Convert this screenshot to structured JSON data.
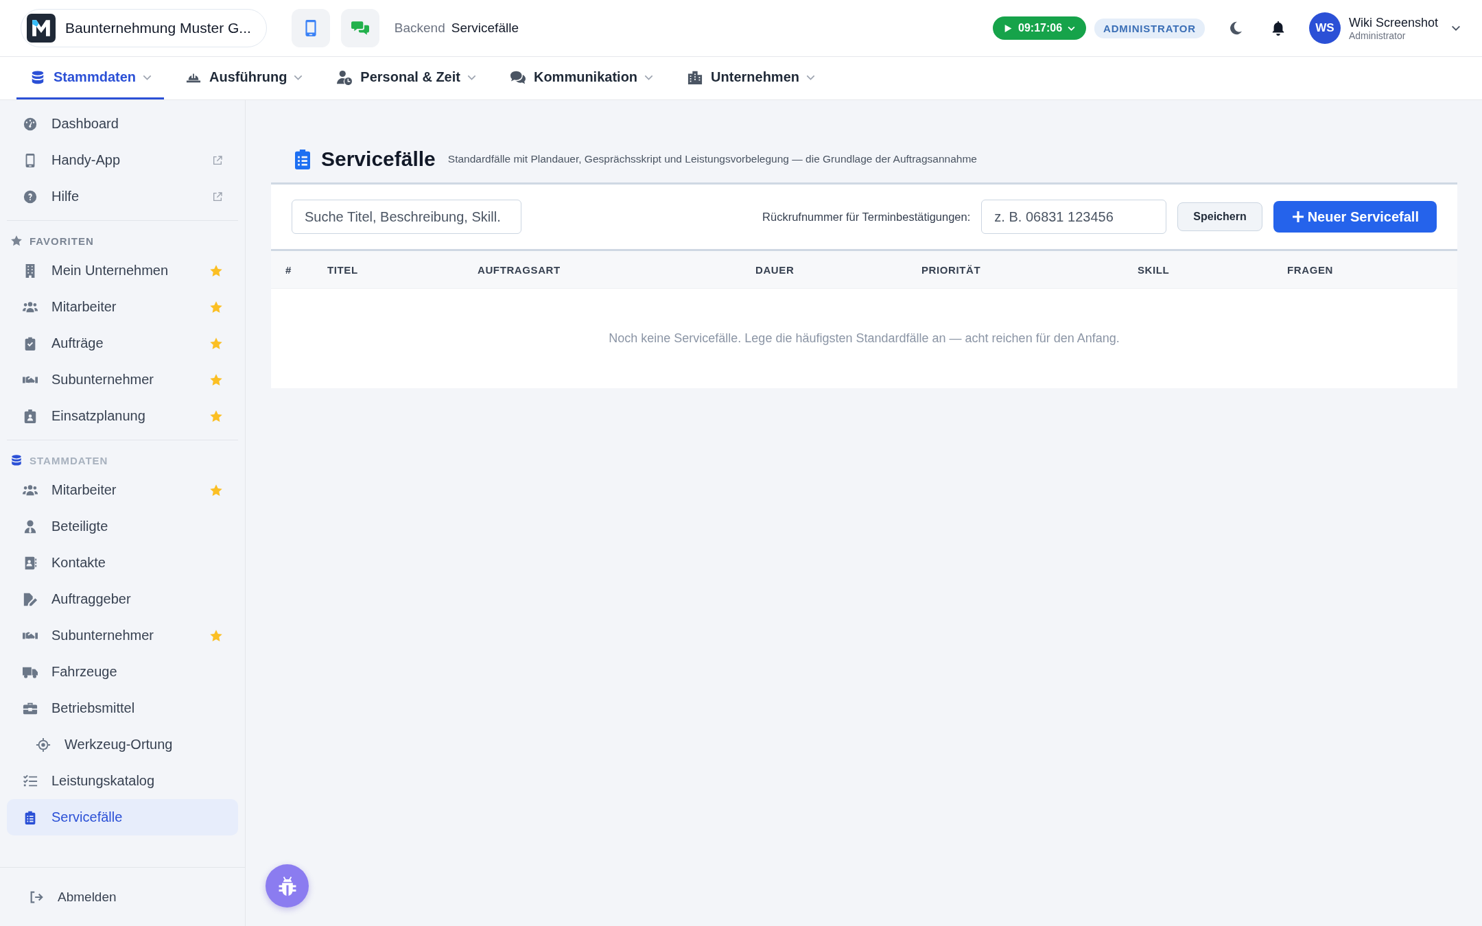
{
  "header": {
    "company": {
      "name": "Baunternehmung Muster G..."
    },
    "breadcrumb": {
      "section": "Backend",
      "page": "Servicefälle"
    },
    "timer": {
      "time": "09:17:06"
    },
    "role_badge": "ADMINISTRATOR",
    "user": {
      "initials": "WS",
      "name": "Wiki Screenshot",
      "role": "Administrator"
    }
  },
  "nav_tabs": [
    {
      "label": "Stammdaten",
      "selected": true
    },
    {
      "label": "Ausführung",
      "selected": false
    },
    {
      "label": "Personal & Zeit",
      "selected": false
    },
    {
      "label": "Kommunikation",
      "selected": false
    },
    {
      "label": "Unternehmen",
      "selected": false
    }
  ],
  "sidebar": {
    "top_items": [
      {
        "label": "Dashboard",
        "external": false
      },
      {
        "label": "Handy-App",
        "external": true
      },
      {
        "label": "Hilfe",
        "external": true
      }
    ],
    "sections": [
      {
        "title": "FAVORITEN",
        "highlighted": false,
        "items": [
          {
            "label": "Mein Unternehmen",
            "favorite": true,
            "selected": false
          },
          {
            "label": "Mitarbeiter",
            "favorite": true,
            "selected": false
          },
          {
            "label": "Aufträge",
            "favorite": true,
            "selected": false
          },
          {
            "label": "Subunternehmer",
            "favorite": true,
            "selected": false
          },
          {
            "label": "Einsatzplanung",
            "favorite": true,
            "selected": false
          }
        ]
      },
      {
        "title": "STAMMDATEN",
        "highlighted": true,
        "items": [
          {
            "label": "Mitarbeiter",
            "favorite": true,
            "selected": false
          },
          {
            "label": "Beteiligte",
            "favorite": false,
            "selected": false
          },
          {
            "label": "Kontakte",
            "favorite": false,
            "selected": false
          },
          {
            "label": "Auftraggeber",
            "favorite": false,
            "selected": false
          },
          {
            "label": "Subunternehmer",
            "favorite": true,
            "selected": false
          },
          {
            "label": "Fahrzeuge",
            "favorite": false,
            "selected": false
          },
          {
            "label": "Betriebsmittel",
            "favorite": false,
            "selected": false,
            "children": [
              {
                "label": "Werkzeug-Ortung",
                "favorite": false,
                "selected": false
              }
            ]
          },
          {
            "label": "Leistungskatalog",
            "favorite": false,
            "selected": false
          },
          {
            "label": "Servicefälle",
            "favorite": false,
            "selected": true
          }
        ]
      }
    ],
    "logout": "Abmelden"
  },
  "page": {
    "title": "Servicefälle",
    "subtitle": "Standardfälle mit Plandauer, Gesprächsskript und Leistungsvorbelegung — die Grundlage der Auftragsannahme"
  },
  "toolbar": {
    "search": {
      "placeholder": "Suche Titel, Beschreibung, Skill."
    },
    "callback_label": "Rückrufnummer für Terminbestätigungen:",
    "callback_field": {
      "placeholder": "z. B. 06831 123456"
    },
    "save_button": "Speichern",
    "new_button": "Neuer Servicefall"
  },
  "table": {
    "columns": [
      "#",
      "TITEL",
      "AUFTRAGSART",
      "DAUER",
      "PRIORITÄT",
      "SKILL",
      "FRAGEN"
    ],
    "empty_message": "Noch keine Servicefälle. Lege die häufigsten Standardfälle an — acht reichen für den Anfang."
  }
}
